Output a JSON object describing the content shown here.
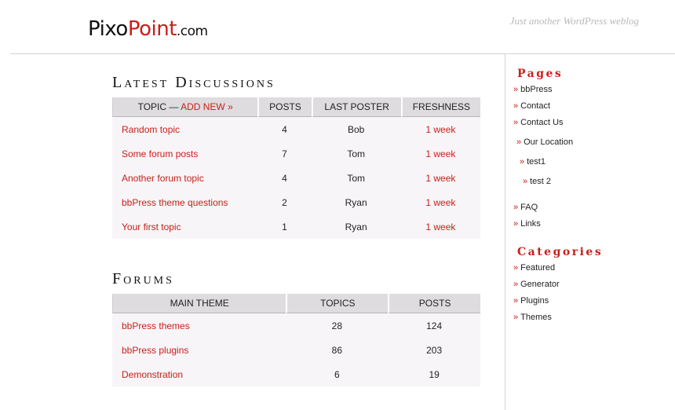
{
  "header": {
    "logo_pixo": "Pixo",
    "logo_point": "Point",
    "logo_dotcom": ".com",
    "tagline": "Just another WordPress weblog"
  },
  "latest": {
    "title": "Latest Discussions",
    "col_topic": "Topic —",
    "add_new": "Add New »",
    "col_posts": "Posts",
    "col_last_poster": "Last Poster",
    "col_freshness": "Freshness",
    "rows": [
      {
        "topic": "Random topic",
        "posts": "4",
        "poster": "Bob",
        "fresh": "1 week"
      },
      {
        "topic": "Some forum posts",
        "posts": "7",
        "poster": "Tom",
        "fresh": "1 week"
      },
      {
        "topic": "Another forum topic",
        "posts": "4",
        "poster": "Tom",
        "fresh": "1 week"
      },
      {
        "topic": "bbPress theme questions",
        "posts": "2",
        "poster": "Ryan",
        "fresh": "1 week"
      },
      {
        "topic": "Your first topic",
        "posts": "1",
        "poster": "Ryan",
        "fresh": "1 week"
      }
    ]
  },
  "forums": {
    "title": "Forums",
    "col_main": "Main Theme",
    "col_topics": "Topics",
    "col_posts": "Posts",
    "rows": [
      {
        "name": "bbPress themes",
        "topics": "28",
        "posts": "124"
      },
      {
        "name": "bbPress plugins",
        "topics": "86",
        "posts": "203"
      },
      {
        "name": "Demonstration",
        "topics": "6",
        "posts": "19"
      }
    ]
  },
  "sidebar": {
    "pages_title": "Pages",
    "pages": [
      "bbPress",
      "Contact",
      "Contact Us",
      "Our Location",
      "test1",
      "test 2",
      "FAQ",
      "Links"
    ],
    "categories_title": "Categories",
    "categories": [
      "Featured",
      "Generator",
      "Plugins",
      "Themes"
    ],
    "bullet": "»"
  }
}
